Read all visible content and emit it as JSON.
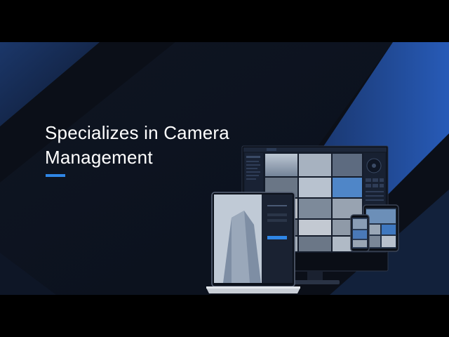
{
  "video": {
    "letterbox_color": "#000000",
    "slide_background": "#0b0f18",
    "accent_color": "#2f86e6"
  },
  "slide": {
    "headline": {
      "line1": "Specializes in Camera",
      "line2": "Management"
    }
  },
  "illustration": {
    "devices": [
      "monitor",
      "laptop",
      "tablet",
      "phone"
    ],
    "subject": "camera-management-software"
  }
}
